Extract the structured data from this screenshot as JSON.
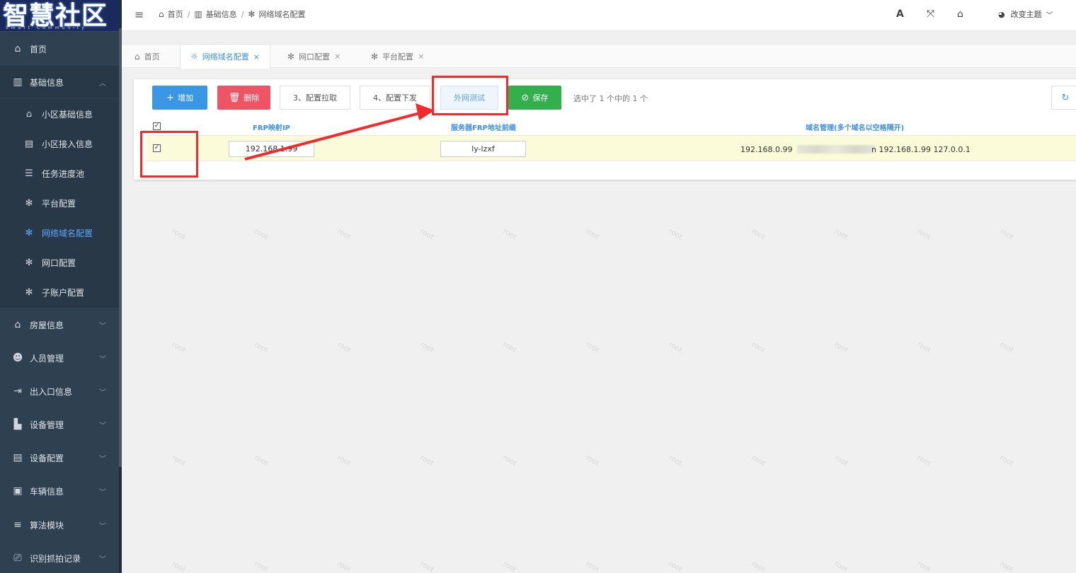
{
  "sidebar": {
    "logo": "智慧社区",
    "logo_sub": "Smart Community",
    "items": [
      {
        "label": "首页",
        "icon": "home-icon"
      },
      {
        "label": "基础信息",
        "icon": "building-icon"
      },
      {
        "label": "房屋信息",
        "icon": "house-icon"
      },
      {
        "label": "人员管理",
        "icon": "users-icon"
      },
      {
        "label": "出入口信息",
        "icon": "signout-icon"
      },
      {
        "label": "设备管理",
        "icon": "device-icon"
      },
      {
        "label": "设备配置",
        "icon": "file-icon"
      },
      {
        "label": "车辆信息",
        "icon": "bus-icon"
      },
      {
        "label": "算法模块",
        "icon": "bars-icon"
      },
      {
        "label": "识别抓拍记录",
        "icon": "record-icon"
      }
    ],
    "subitems": [
      {
        "label": "小区基础信息",
        "icon": "institution-icon"
      },
      {
        "label": "小区接入信息",
        "icon": "building-o-icon"
      },
      {
        "label": "任务进度池",
        "icon": "list-icon"
      },
      {
        "label": "平台配置",
        "icon": "gear-icon"
      },
      {
        "label": "网络域名配置",
        "icon": "gear-icon",
        "active": true
      },
      {
        "label": "网口配置",
        "icon": "gear-icon"
      },
      {
        "label": "子账户配置",
        "icon": "gear-icon"
      }
    ]
  },
  "header": {
    "breadcrumb": [
      "首页",
      "基础信息",
      "网络域名配置"
    ],
    "font_icon_label": "A",
    "theme_label": "改变主题"
  },
  "tabs": [
    {
      "label": "首页",
      "icon": "home-icon",
      "closable": false
    },
    {
      "label": "网络域名配置",
      "icon": "gear-icon",
      "closable": true,
      "active": true
    },
    {
      "label": "网口配置",
      "icon": "gear-icon",
      "closable": true
    },
    {
      "label": "平台配置",
      "icon": "gear-icon",
      "closable": true
    }
  ],
  "toolbar": {
    "add_label": "增加",
    "delete_label": "删除",
    "pull_label": "3、配置拉取",
    "push_label": "4、配置下发",
    "test_label": "外网测试",
    "save_label": "保存",
    "selected_text": "选中了 1 个中的 1 个"
  },
  "table": {
    "columns": [
      "FRP映射IP",
      "服务器FRP地址前缀",
      "域名管理(多个域名以空格隔开)"
    ],
    "rows": [
      {
        "checked": true,
        "frp_ip": "192.168.1.99",
        "prefix": "ly-lzxf",
        "domains_left": "192.168.0.99",
        "domains_right": "n 192.168.1.99 127.0.0.1"
      }
    ]
  },
  "watermark_text": "root",
  "colors": {
    "sidebar_bg": "#2f4050",
    "accent": "#3a8ee6",
    "danger": "#ed5565",
    "success": "#33b04d",
    "annotation_red": "#ef2b2b"
  }
}
